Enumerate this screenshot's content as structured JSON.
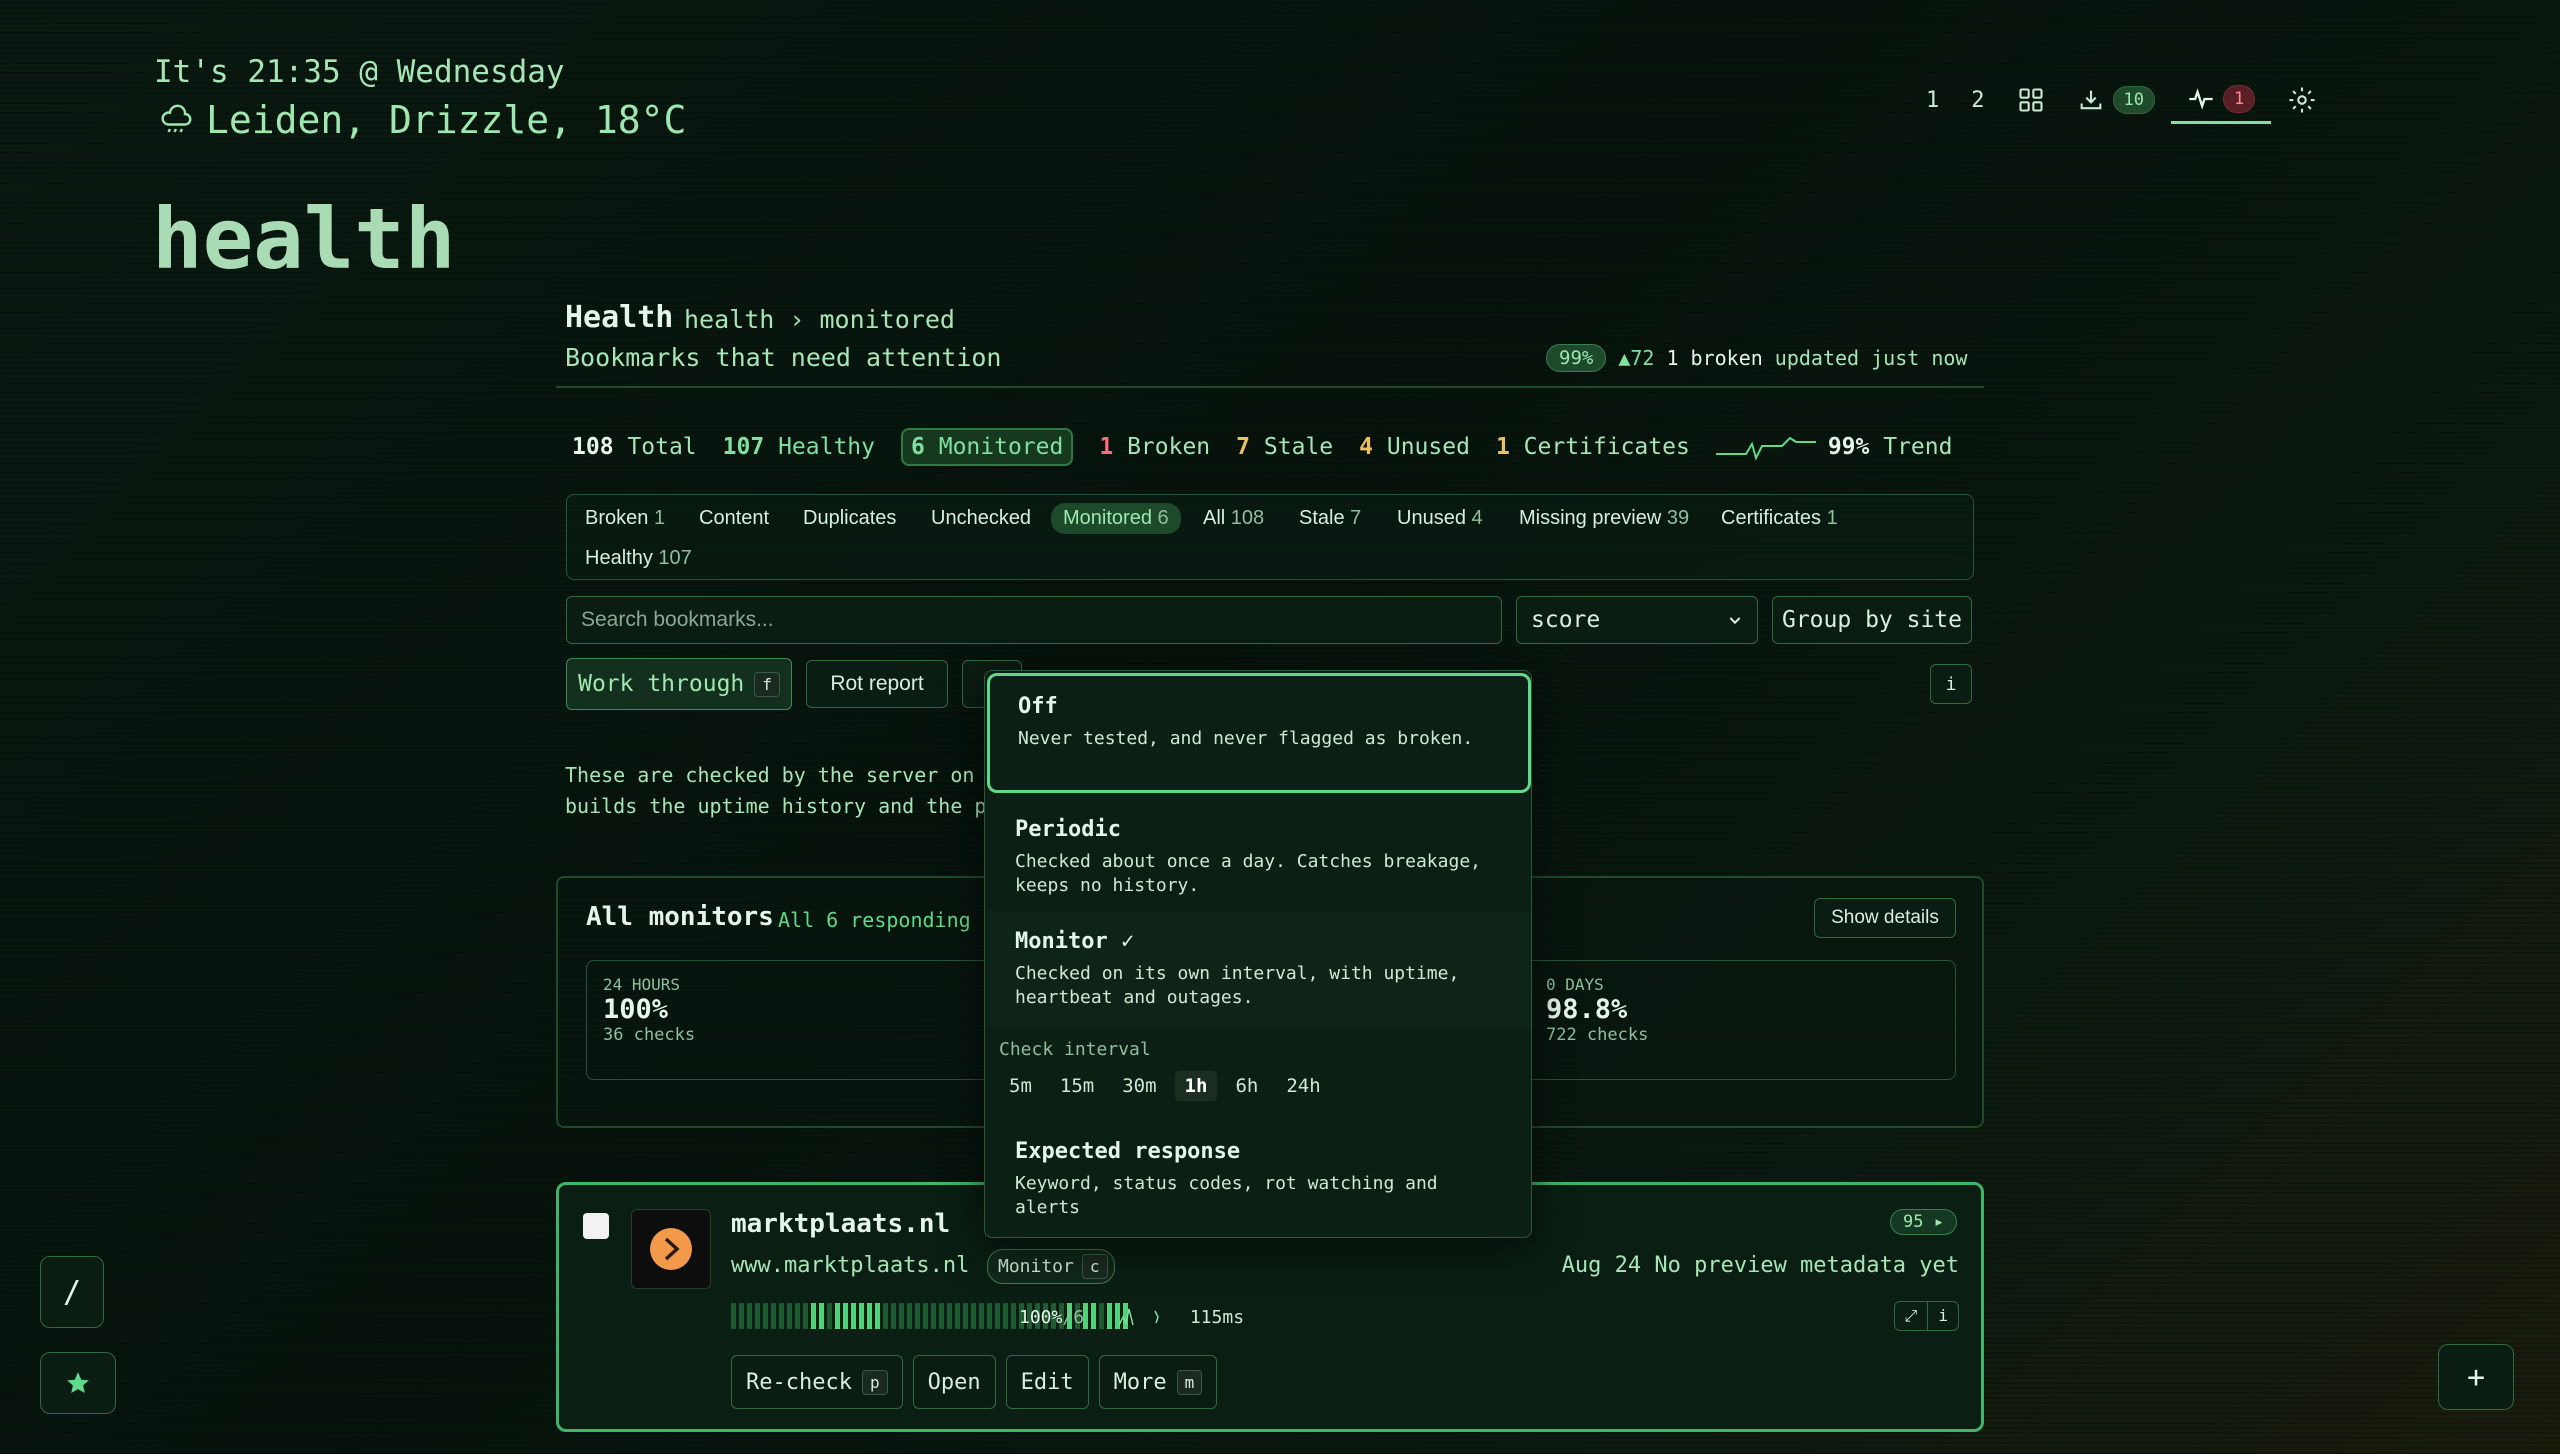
{
  "header": {
    "clock": "It's 21:35 @ Wednesday",
    "weather": "Leiden, Drizzle, 18°C",
    "page_title": "health"
  },
  "topnav": {
    "item1": "1",
    "item2": "2",
    "downloads_count": "10",
    "health_count": "1"
  },
  "panel": {
    "title": "Health",
    "breadcrumb": "health › monitored",
    "subtitle": "Bookmarks that need attention",
    "health_pct": "99%",
    "delta": "▲72",
    "broken_text": "1 broken",
    "updated": "updated just now"
  },
  "stats": [
    {
      "num": "108",
      "label": "Total",
      "color": "#e6f5ea"
    },
    {
      "num": "107",
      "label": "Healthy",
      "color": "#7fe0a0"
    },
    {
      "num": "6",
      "label": "Monitored",
      "color": "#7fe0a0"
    },
    {
      "num": "1",
      "label": "Broken",
      "color": "#ff6b7a"
    },
    {
      "num": "7",
      "label": "Stale",
      "color": "#f0c060"
    },
    {
      "num": "4",
      "label": "Unused",
      "color": "#f0c060"
    },
    {
      "num": "1",
      "label": "Certificates",
      "color": "#f0c060"
    },
    {
      "num": "99%",
      "label": "Trend",
      "color": "#e6f5ea"
    }
  ],
  "filters": {
    "broken": "Broken",
    "broken_n": "1",
    "content": "Content",
    "duplicates": "Duplicates",
    "unchecked": "Unchecked",
    "monitored": "Monitored",
    "monitored_n": "6",
    "all": "All",
    "all_n": "108",
    "stale": "Stale",
    "stale_n": "7",
    "unused": "Unused",
    "unused_n": "4",
    "missing": "Missing preview",
    "missing_n": "39",
    "certs": "Certificates",
    "certs_n": "1",
    "healthy": "Healthy",
    "healthy_n": "107"
  },
  "search": {
    "placeholder": "Search bookmarks..."
  },
  "sort": {
    "selected": "score"
  },
  "group_label": "Group by site",
  "toolbar": {
    "work_through": "Work through",
    "work_key": "f",
    "rot_report": "Rot report",
    "info": "i"
  },
  "description": {
    "line1": "These are checked by the server on",
    "line2": "builds the uptime history and the pa"
  },
  "monitors": {
    "title": "All monitors",
    "subtitle": "All 6 responding",
    "show_details": "Show details",
    "card1": {
      "label": "24 HOURS",
      "value": "100%",
      "sub": "36 checks"
    },
    "card3": {
      "label": "0 DAYS",
      "value": "98.8%",
      "sub": "722 checks"
    }
  },
  "popover": {
    "off_title": "Off",
    "off_desc": "Never tested, and never flagged as broken.",
    "periodic_title": "Periodic",
    "periodic_desc": "Checked about once a day. Catches breakage, keeps no history.",
    "monitor_title": "Monitor ✓",
    "monitor_desc": "Checked on its own interval, with uptime, heartbeat and outages.",
    "interval_label": "Check interval",
    "intervals": [
      "5m",
      "15m",
      "30m",
      "1h",
      "6h",
      "24h"
    ],
    "selected_interval": "1h",
    "expected_title": "Expected response",
    "expected_desc": "Keyword, status codes, rot watching and alerts"
  },
  "bookmark": {
    "title": "marktplaats.nl",
    "url": "www.marktplaats.nl",
    "chip": "Monitor",
    "chip_key": "c",
    "score": "95 ▸",
    "meta": "Aug 24 No preview metadata yet",
    "uptime": "100%",
    "uptime_n": "/6",
    "latency": "115ms",
    "recheck": "Re-check",
    "recheck_key": "p",
    "open": "Open",
    "edit": "Edit",
    "more": "More",
    "more_key": "m",
    "info": "i"
  },
  "float": {
    "slash": "/",
    "plus": "+"
  },
  "colors": {
    "accent": "#7fe0a0",
    "broken": "#ff6b7a",
    "warn": "#f0c060"
  },
  "icons": [
    "cloud-rain-icon",
    "grid-icon",
    "download-icon",
    "pulse-icon",
    "gear-icon",
    "star-icon",
    "sparkline-icon"
  ]
}
